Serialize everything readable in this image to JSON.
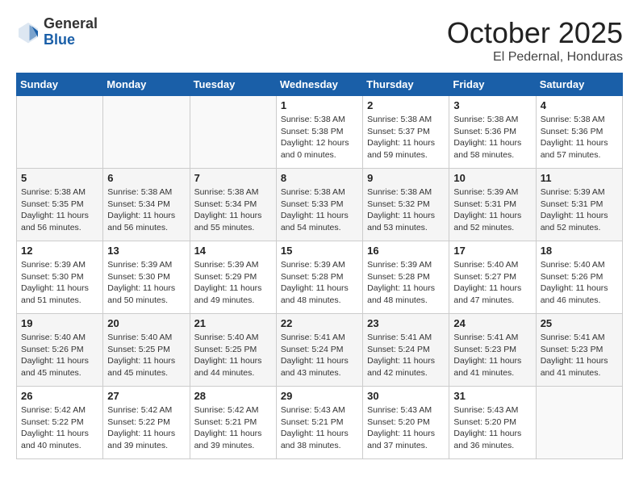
{
  "logo": {
    "general": "General",
    "blue": "Blue"
  },
  "title": "October 2025",
  "location": "El Pedernal, Honduras",
  "days_header": [
    "Sunday",
    "Monday",
    "Tuesday",
    "Wednesday",
    "Thursday",
    "Friday",
    "Saturday"
  ],
  "weeks": [
    [
      {
        "day": "",
        "info": ""
      },
      {
        "day": "",
        "info": ""
      },
      {
        "day": "",
        "info": ""
      },
      {
        "day": "1",
        "info": "Sunrise: 5:38 AM\nSunset: 5:38 PM\nDaylight: 12 hours\nand 0 minutes."
      },
      {
        "day": "2",
        "info": "Sunrise: 5:38 AM\nSunset: 5:37 PM\nDaylight: 11 hours\nand 59 minutes."
      },
      {
        "day": "3",
        "info": "Sunrise: 5:38 AM\nSunset: 5:36 PM\nDaylight: 11 hours\nand 58 minutes."
      },
      {
        "day": "4",
        "info": "Sunrise: 5:38 AM\nSunset: 5:36 PM\nDaylight: 11 hours\nand 57 minutes."
      }
    ],
    [
      {
        "day": "5",
        "info": "Sunrise: 5:38 AM\nSunset: 5:35 PM\nDaylight: 11 hours\nand 56 minutes."
      },
      {
        "day": "6",
        "info": "Sunrise: 5:38 AM\nSunset: 5:34 PM\nDaylight: 11 hours\nand 56 minutes."
      },
      {
        "day": "7",
        "info": "Sunrise: 5:38 AM\nSunset: 5:34 PM\nDaylight: 11 hours\nand 55 minutes."
      },
      {
        "day": "8",
        "info": "Sunrise: 5:38 AM\nSunset: 5:33 PM\nDaylight: 11 hours\nand 54 minutes."
      },
      {
        "day": "9",
        "info": "Sunrise: 5:38 AM\nSunset: 5:32 PM\nDaylight: 11 hours\nand 53 minutes."
      },
      {
        "day": "10",
        "info": "Sunrise: 5:39 AM\nSunset: 5:31 PM\nDaylight: 11 hours\nand 52 minutes."
      },
      {
        "day": "11",
        "info": "Sunrise: 5:39 AM\nSunset: 5:31 PM\nDaylight: 11 hours\nand 52 minutes."
      }
    ],
    [
      {
        "day": "12",
        "info": "Sunrise: 5:39 AM\nSunset: 5:30 PM\nDaylight: 11 hours\nand 51 minutes."
      },
      {
        "day": "13",
        "info": "Sunrise: 5:39 AM\nSunset: 5:30 PM\nDaylight: 11 hours\nand 50 minutes."
      },
      {
        "day": "14",
        "info": "Sunrise: 5:39 AM\nSunset: 5:29 PM\nDaylight: 11 hours\nand 49 minutes."
      },
      {
        "day": "15",
        "info": "Sunrise: 5:39 AM\nSunset: 5:28 PM\nDaylight: 11 hours\nand 48 minutes."
      },
      {
        "day": "16",
        "info": "Sunrise: 5:39 AM\nSunset: 5:28 PM\nDaylight: 11 hours\nand 48 minutes."
      },
      {
        "day": "17",
        "info": "Sunrise: 5:40 AM\nSunset: 5:27 PM\nDaylight: 11 hours\nand 47 minutes."
      },
      {
        "day": "18",
        "info": "Sunrise: 5:40 AM\nSunset: 5:26 PM\nDaylight: 11 hours\nand 46 minutes."
      }
    ],
    [
      {
        "day": "19",
        "info": "Sunrise: 5:40 AM\nSunset: 5:26 PM\nDaylight: 11 hours\nand 45 minutes."
      },
      {
        "day": "20",
        "info": "Sunrise: 5:40 AM\nSunset: 5:25 PM\nDaylight: 11 hours\nand 45 minutes."
      },
      {
        "day": "21",
        "info": "Sunrise: 5:40 AM\nSunset: 5:25 PM\nDaylight: 11 hours\nand 44 minutes."
      },
      {
        "day": "22",
        "info": "Sunrise: 5:41 AM\nSunset: 5:24 PM\nDaylight: 11 hours\nand 43 minutes."
      },
      {
        "day": "23",
        "info": "Sunrise: 5:41 AM\nSunset: 5:24 PM\nDaylight: 11 hours\nand 42 minutes."
      },
      {
        "day": "24",
        "info": "Sunrise: 5:41 AM\nSunset: 5:23 PM\nDaylight: 11 hours\nand 41 minutes."
      },
      {
        "day": "25",
        "info": "Sunrise: 5:41 AM\nSunset: 5:23 PM\nDaylight: 11 hours\nand 41 minutes."
      }
    ],
    [
      {
        "day": "26",
        "info": "Sunrise: 5:42 AM\nSunset: 5:22 PM\nDaylight: 11 hours\nand 40 minutes."
      },
      {
        "day": "27",
        "info": "Sunrise: 5:42 AM\nSunset: 5:22 PM\nDaylight: 11 hours\nand 39 minutes."
      },
      {
        "day": "28",
        "info": "Sunrise: 5:42 AM\nSunset: 5:21 PM\nDaylight: 11 hours\nand 39 minutes."
      },
      {
        "day": "29",
        "info": "Sunrise: 5:43 AM\nSunset: 5:21 PM\nDaylight: 11 hours\nand 38 minutes."
      },
      {
        "day": "30",
        "info": "Sunrise: 5:43 AM\nSunset: 5:20 PM\nDaylight: 11 hours\nand 37 minutes."
      },
      {
        "day": "31",
        "info": "Sunrise: 5:43 AM\nSunset: 5:20 PM\nDaylight: 11 hours\nand 36 minutes."
      },
      {
        "day": "",
        "info": ""
      }
    ]
  ]
}
